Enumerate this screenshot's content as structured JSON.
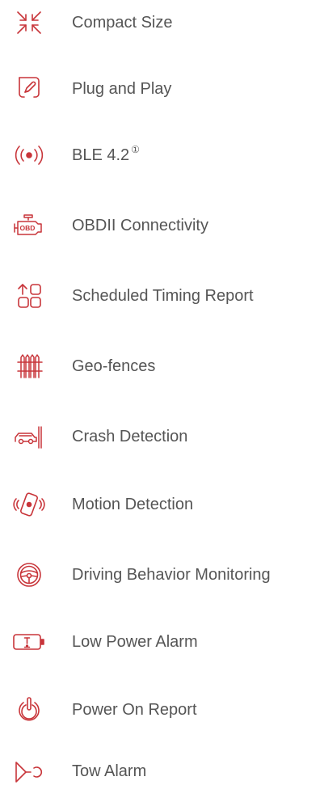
{
  "colors": {
    "icon": "#c8353a",
    "text": "#555555"
  },
  "features": [
    {
      "icon": "compact-size-icon",
      "label": "Compact Size"
    },
    {
      "icon": "plug-and-play-icon",
      "label": "Plug and Play"
    },
    {
      "icon": "ble-signal-icon",
      "label": "BLE 4.2",
      "note": "①"
    },
    {
      "icon": "obd-engine-icon",
      "label": "OBDII Connectivity"
    },
    {
      "icon": "scheduled-report-icon",
      "label": "Scheduled Timing Report"
    },
    {
      "icon": "geo-fence-icon",
      "label": "Geo-fences"
    },
    {
      "icon": "crash-detection-icon",
      "label": "Crash Detection"
    },
    {
      "icon": "motion-detection-icon",
      "label": "Motion Detection"
    },
    {
      "icon": "steering-wheel-icon",
      "label": "Driving Behavior Monitoring"
    },
    {
      "icon": "low-battery-icon",
      "label": "Low Power Alarm"
    },
    {
      "icon": "power-icon",
      "label": "Power On Report"
    },
    {
      "icon": "tow-alarm-icon",
      "label": "Tow Alarm"
    }
  ]
}
